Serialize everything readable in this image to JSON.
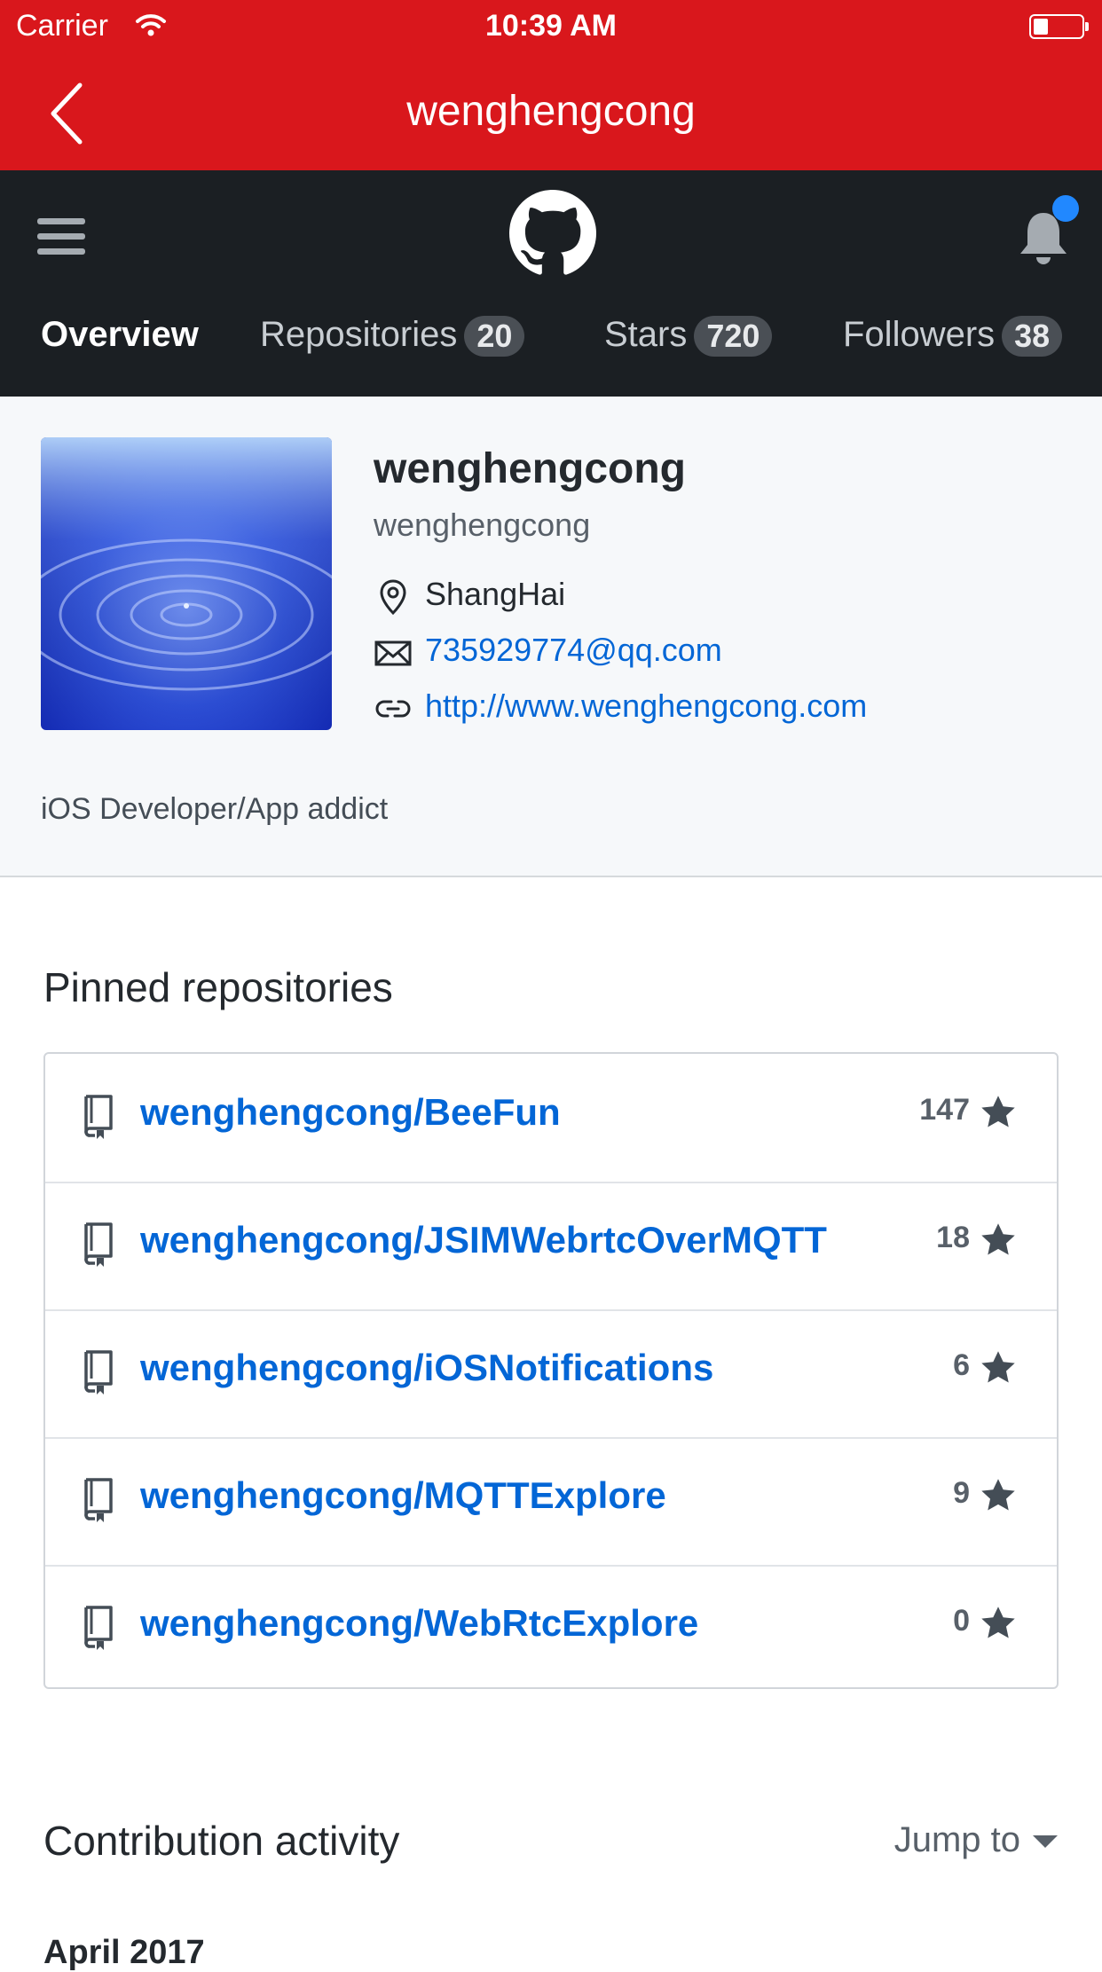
{
  "status_bar": {
    "carrier": "Carrier",
    "time": "10:39 AM",
    "battery_level": 0.2
  },
  "nav": {
    "title": "wenghengcong"
  },
  "tabs": [
    {
      "label": "Overview",
      "count": ""
    },
    {
      "label": "Repositories",
      "count": "20"
    },
    {
      "label": "Stars",
      "count": "720"
    },
    {
      "label": "Followers",
      "count": "38"
    }
  ],
  "profile": {
    "name": "wenghengcong",
    "login": "wenghengcong",
    "location": "ShangHai",
    "email": "735929774@qq.com",
    "website": "http://www.wenghengcong.com",
    "bio": "iOS Developer/App addict"
  },
  "pinned": {
    "title": "Pinned repositories",
    "repos": [
      {
        "name": "wenghengcong/BeeFun",
        "stars": "147"
      },
      {
        "name": "wenghengcong/JSIMWebrtcOverMQTT",
        "stars": "18"
      },
      {
        "name": "wenghengcong/iOSNotifications",
        "stars": "6"
      },
      {
        "name": "wenghengcong/MQTTExplore",
        "stars": "9"
      },
      {
        "name": "wenghengcong/WebRtcExplore",
        "stars": "0"
      }
    ]
  },
  "contribution": {
    "title": "Contribution activity",
    "jump_label": "Jump to",
    "month": "April 2017"
  },
  "colors": {
    "nav_red": "#d9171c",
    "header_dark": "#1b1f23",
    "link_blue": "#0366d6",
    "notification_dot": "#2188ff"
  },
  "icons": [
    "back-chevron-icon",
    "hamburger-menu-icon",
    "github-octocat-icon",
    "bell-icon",
    "location-pin-icon",
    "mail-icon",
    "link-icon",
    "repo-book-icon",
    "star-icon",
    "caret-down-icon"
  ]
}
